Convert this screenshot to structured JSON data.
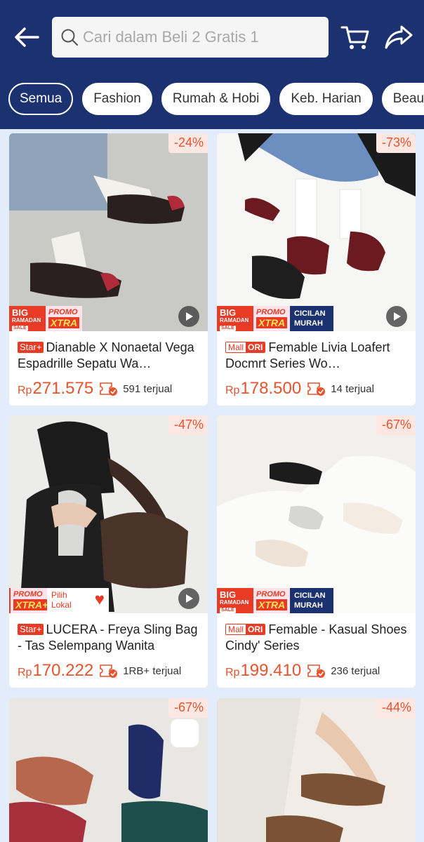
{
  "header": {
    "search_placeholder": "Cari dalam Beli 2 Gratis 1"
  },
  "chips": [
    "Semua",
    "Fashion",
    "Rumah & Hobi",
    "Keb. Harian",
    "Beauty"
  ],
  "badges": {
    "big": [
      "BIG",
      "RAMADAN",
      "SALE"
    ],
    "promo": "PROMO",
    "xtra": "XTRA",
    "xtra_plus": "XTRA+",
    "cicilan": [
      "CICILAN",
      "MURAH"
    ],
    "pilih": [
      "Pilih",
      "Lokal"
    ],
    "star": "Star+",
    "mall": "Mall",
    "ori": "ORI"
  },
  "products": [
    {
      "discount": "-24%",
      "title": "Dianable X Nonaetal Vega Espadrille Sepatu Wa…",
      "currency": "Rp",
      "price": "271.575",
      "sold": "591 terjual"
    },
    {
      "discount": "-73%",
      "title": "Femable  Livia Loafert Docmrt Series Wo…",
      "currency": "Rp",
      "price": "178.500",
      "sold": "14 terjual"
    },
    {
      "discount": "-47%",
      "title": "LUCERA - Freya Sling Bag - Tas Selempang Wanita",
      "currency": "Rp",
      "price": "170.222",
      "sold": "1RB+ terjual"
    },
    {
      "discount": "-67%",
      "title": "Femable - Kasual Shoes Cindy' Series",
      "currency": "Rp",
      "price": "199.410",
      "sold": "236 terjual"
    },
    {
      "discount": "-67%"
    },
    {
      "discount": "-44%"
    }
  ],
  "colors": {
    "header_bg": "#1c3270",
    "page_bg": "#e3ecfa",
    "price": "#e8532d",
    "brand_red": "#e83a25"
  }
}
